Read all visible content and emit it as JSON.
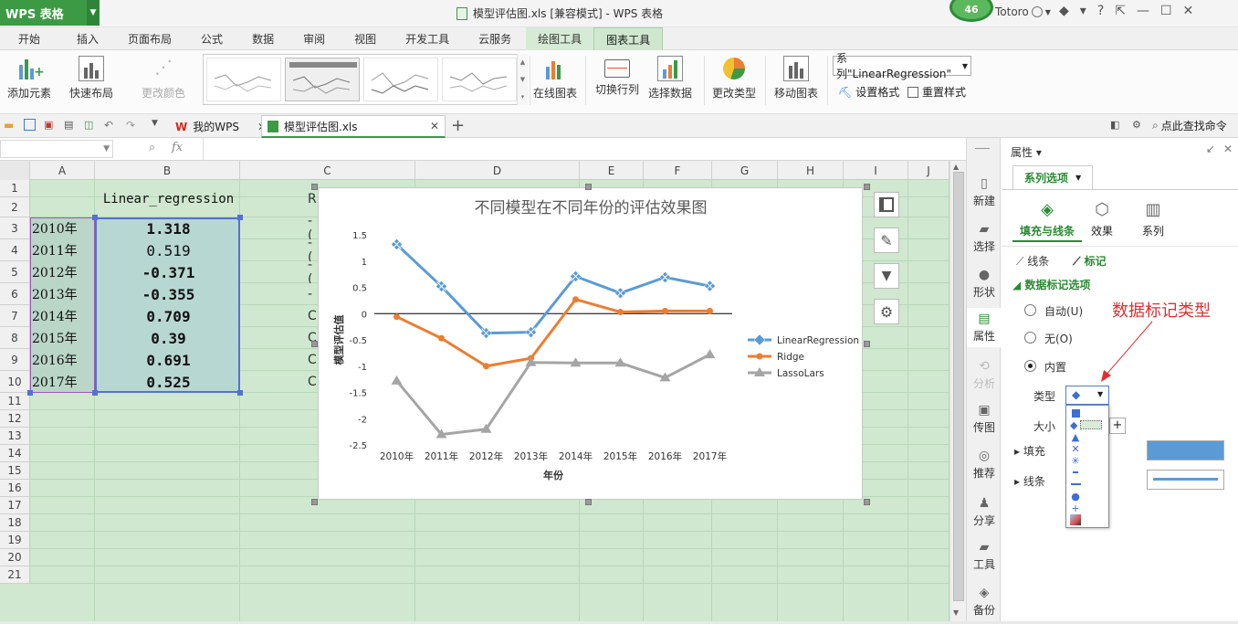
{
  "app": {
    "name": "WPS 表格",
    "window_title": "模型评估图.xls [兼容模式] - WPS 表格",
    "badge_count": "46",
    "user": "Totoro"
  },
  "menu": {
    "tabs": [
      "开始",
      "插入",
      "页面布局",
      "公式",
      "数据",
      "审阅",
      "视图",
      "开发工具",
      "云服务",
      "绘图工具",
      "图表工具"
    ],
    "active": "图表工具"
  },
  "ribbon": {
    "add_element": "添加元素",
    "quick_layout": "快速布局",
    "change_color": "更改颜色",
    "online_chart": "在线图表",
    "switch_row_col": "切换行列",
    "select_data": "选择数据",
    "change_type": "更改类型",
    "move_chart": "移动图表",
    "series_select": "系列\"LinearRegression\"",
    "set_format": "设置格式",
    "reset_style": "重置样式"
  },
  "doc_tabs": {
    "wps": "我的WPS",
    "file": "模型评估图.xls",
    "search": "点此查找命令"
  },
  "formula": {
    "fx": "fx"
  },
  "grid": {
    "columns": [
      "A",
      "B",
      "C",
      "D",
      "E",
      "F",
      "G",
      "H",
      "I",
      "J"
    ],
    "rows": [
      "1",
      "2",
      "3",
      "4",
      "5",
      "6",
      "7",
      "8",
      "9",
      "10",
      "11",
      "12",
      "13",
      "14",
      "15",
      "16",
      "17",
      "18",
      "19",
      "20",
      "21"
    ],
    "b2_header": "Linear_regression",
    "c2_partial": "R",
    "years": [
      "2010年",
      "2011年",
      "2012年",
      "2013年",
      "2014年",
      "2015年",
      "2016年",
      "2017年"
    ],
    "values": [
      "1.318",
      "0.519",
      "-0.371",
      "-0.355",
      "0.709",
      "0.39",
      "0.691",
      "0.525"
    ],
    "c_partial": [
      "-(",
      "-(",
      "-(",
      "-",
      "C",
      "C",
      "C",
      "C"
    ]
  },
  "chart_data": {
    "type": "line",
    "title": "不同模型在不同年份的评估效果图",
    "xlabel": "年份",
    "ylabel": "模型评估值",
    "categories": [
      "2010年",
      "2011年",
      "2012年",
      "2013年",
      "2014年",
      "2015年",
      "2016年",
      "2017年"
    ],
    "ylim": [
      -2.5,
      1.5
    ],
    "yticks": [
      "1.5",
      "1",
      "0.5",
      "0",
      "-0.5",
      "-1",
      "-1.5",
      "-2",
      "-2.5"
    ],
    "legend_position": "right",
    "series": [
      {
        "name": "LinearRegression",
        "color": "#5b9bd5",
        "marker": "diamond",
        "values": [
          1.318,
          0.519,
          -0.371,
          -0.355,
          0.709,
          0.39,
          0.691,
          0.525
        ]
      },
      {
        "name": "Ridge",
        "color": "#ed7d31",
        "marker": "circle",
        "values": [
          -0.06,
          -0.47,
          -1.0,
          -0.85,
          0.27,
          0.03,
          0.05,
          0.05
        ]
      },
      {
        "name": "LassoLars",
        "color": "#a5a5a5",
        "marker": "triangle",
        "values": [
          -1.28,
          -2.3,
          -2.2,
          -0.93,
          -0.94,
          -0.94,
          -1.22,
          -0.78
        ]
      }
    ]
  },
  "sidebar": {
    "items": [
      "新建",
      "选择",
      "形状",
      "属性",
      "分析",
      "传图",
      "推荐",
      "分享",
      "工具",
      "备份"
    ]
  },
  "panel": {
    "title": "属性",
    "series_options": "系列选项",
    "tabs": [
      "填充与线条",
      "效果",
      "系列"
    ],
    "subtabs": [
      "线条",
      "标记"
    ],
    "section": "数据标记选项",
    "radios": [
      "自动(U)",
      "无(O)",
      "内置"
    ],
    "type_label": "类型",
    "size_label": "大小",
    "fill_label": "填充",
    "line_label": "线条",
    "fill_color": "#5b9bd5",
    "annotation": "数据标记类型"
  }
}
